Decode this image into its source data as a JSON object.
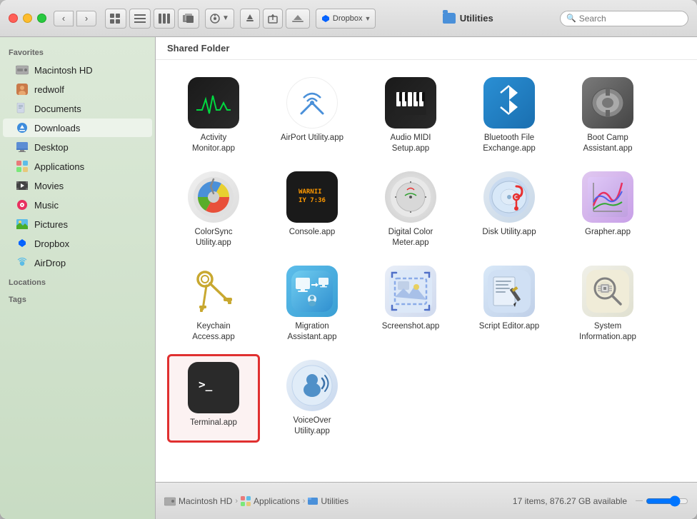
{
  "window": {
    "title": "Utilities",
    "traffic_lights": [
      "close",
      "minimize",
      "maximize"
    ]
  },
  "toolbar": {
    "view_icon_grid": "⊞",
    "view_icon_list": "☰",
    "view_columns": "⊟",
    "view_cover": "⬛",
    "arrange_label": "⚙",
    "action_label": "↑",
    "share_label": "□",
    "dropbox_label": "Dropbox",
    "search_placeholder": "Search"
  },
  "shared_folder_label": "Shared Folder",
  "sidebar": {
    "favorites_label": "Favorites",
    "items": [
      {
        "label": "Macintosh HD",
        "icon": "hd"
      },
      {
        "label": "redwolf",
        "icon": "user"
      },
      {
        "label": "Documents",
        "icon": "docs"
      },
      {
        "label": "Downloads",
        "icon": "downloads"
      },
      {
        "label": "Desktop",
        "icon": "desktop"
      },
      {
        "label": "Applications",
        "icon": "apps"
      },
      {
        "label": "Movies",
        "icon": "movies"
      },
      {
        "label": "Music",
        "icon": "music"
      },
      {
        "label": "Pictures",
        "icon": "pictures"
      },
      {
        "label": "Dropbox",
        "icon": "dropbox"
      },
      {
        "label": "AirDrop",
        "icon": "airdrop"
      }
    ],
    "locations_label": "Locations",
    "tags_label": "Tags"
  },
  "files": [
    {
      "name": "Activity\nMonitor.app",
      "icon": "activity",
      "selected": false
    },
    {
      "name": "AirPort Utility.app",
      "icon": "airport",
      "selected": false
    },
    {
      "name": "Audio MIDI\nSetup.app",
      "icon": "midi",
      "selected": false
    },
    {
      "name": "Bluetooth File\nExchange.app",
      "icon": "bluetooth",
      "selected": false
    },
    {
      "name": "Boot Camp\nAssistant.app",
      "icon": "bootcamp",
      "selected": false
    },
    {
      "name": "ColorSync\nUtility.app",
      "icon": "colorsync",
      "selected": false
    },
    {
      "name": "Console.app",
      "icon": "console",
      "selected": false
    },
    {
      "name": "Digital Color\nMeter.app",
      "icon": "digitalcolor",
      "selected": false
    },
    {
      "name": "Disk Utility.app",
      "icon": "diskutil",
      "selected": false
    },
    {
      "name": "Grapher.app",
      "icon": "grapher",
      "selected": false
    },
    {
      "name": "Keychain\nAccess.app",
      "icon": "keychain",
      "selected": false
    },
    {
      "name": "Migration\nAssistant.app",
      "icon": "migration",
      "selected": false
    },
    {
      "name": "Screenshot.app",
      "icon": "screenshot",
      "selected": false
    },
    {
      "name": "Script Editor.app",
      "icon": "scripteditor",
      "selected": false
    },
    {
      "name": "System\nInformation.app",
      "icon": "sysinfo",
      "selected": false
    },
    {
      "name": "Terminal.app",
      "icon": "terminal",
      "selected": true
    },
    {
      "name": "VoiceOver\nUtility.app",
      "icon": "voiceover",
      "selected": false
    }
  ],
  "status_bar": {
    "breadcrumb": [
      "Macintosh HD",
      "Applications",
      "Utilities"
    ],
    "info": "17 items, 876.27 GB available"
  }
}
